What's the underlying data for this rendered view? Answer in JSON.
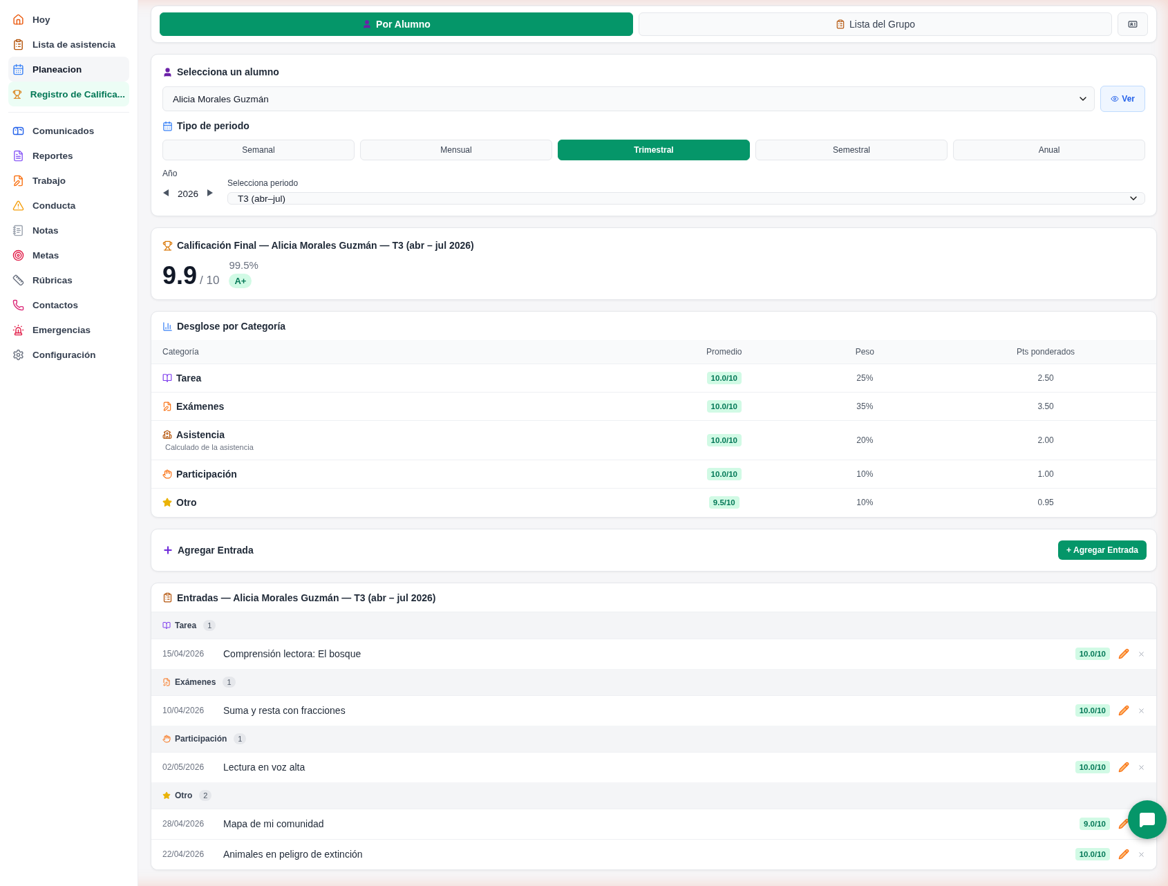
{
  "sidebar": {
    "items": [
      {
        "label": "Hoy",
        "selected": false,
        "hovered": false
      },
      {
        "label": "Lista de asistencia",
        "selected": false,
        "hovered": false
      },
      {
        "label": "Planeacion",
        "selected": false,
        "hovered": true
      },
      {
        "label": "Registro de Califica...",
        "selected": true,
        "hovered": false
      }
    ],
    "items_secondary": [
      {
        "label": "Comunicados",
        "selected": false,
        "hovered": false
      },
      {
        "label": "Reportes",
        "selected": false,
        "hovered": false
      },
      {
        "label": "Trabajo",
        "selected": false,
        "hovered": false
      },
      {
        "label": "Conducta",
        "selected": false,
        "hovered": false
      },
      {
        "label": "Notas",
        "selected": false,
        "hovered": false
      },
      {
        "label": "Metas",
        "selected": false,
        "hovered": false
      },
      {
        "label": "Rúbricas",
        "selected": false,
        "hovered": false
      },
      {
        "label": "Contactos",
        "selected": false,
        "hovered": false
      },
      {
        "label": "Emergencias",
        "selected": false,
        "hovered": false
      },
      {
        "label": "Configuración",
        "selected": false,
        "hovered": false
      }
    ]
  },
  "view_tabs": [
    {
      "label": "Por Alumno",
      "selected": true
    },
    {
      "label": "Lista del Grupo",
      "selected": false
    }
  ],
  "student_picker": {
    "label": "Selecciona un alumno",
    "value": "Alicia Morales Guzmán",
    "view_button": "Ver"
  },
  "period_type": {
    "label": "Tipo de periodo",
    "options": [
      {
        "label": "Semanal",
        "selected": false
      },
      {
        "label": "Mensual",
        "selected": false
      },
      {
        "label": "Trimestral",
        "selected": true
      },
      {
        "label": "Semestral",
        "selected": false
      },
      {
        "label": "Anual",
        "selected": false
      }
    ]
  },
  "year": {
    "label": "Año",
    "value": "2026"
  },
  "period": {
    "label": "Selecciona periodo",
    "value": "T3 (abr–jul)"
  },
  "final_grade": {
    "title": "Calificación Final — Alicia Morales Guzmán — T3 (abr – jul 2026)",
    "score": "9.9",
    "out_of": "/ 10",
    "percent": "99.5%",
    "letter": "A+"
  },
  "breakdown": {
    "title": "Desglose por Categoría",
    "columns": [
      "Categoría",
      "Promedio",
      "Peso",
      "Pts ponderados"
    ],
    "rows": [
      {
        "kind": "homework",
        "category": "Tarea",
        "average": "10.0/10",
        "weight": "25%",
        "points": "2.50"
      },
      {
        "kind": "exam",
        "category": "Exámenes",
        "average": "10.0/10",
        "weight": "35%",
        "points": "3.50"
      },
      {
        "kind": "attendance",
        "category": "Asistencia",
        "note": "Calculado de la asistencia",
        "average": "10.0/10",
        "weight": "20%",
        "points": "2.00"
      },
      {
        "kind": "participation",
        "category": "Participación",
        "average": "10.0/10",
        "weight": "10%",
        "points": "1.00"
      },
      {
        "kind": "other",
        "category": "Otro",
        "average": "9.5/10",
        "weight": "10%",
        "points": "0.95"
      }
    ]
  },
  "add_entry": {
    "title": "Agregar Entrada",
    "button": "+ Agregar Entrada"
  },
  "entries": {
    "title": "Entradas — Alicia Morales Guzmán — T3 (abr – jul 2026)",
    "groups": [
      {
        "kind": "homework",
        "name": "Tarea",
        "count": "1",
        "items": [
          {
            "date": "15/04/2026",
            "title": "Comprensión lectora: El bosque",
            "score": "10.0/10"
          }
        ]
      },
      {
        "kind": "exam",
        "name": "Exámenes",
        "count": "1",
        "items": [
          {
            "date": "10/04/2026",
            "title": "Suma y resta con fracciones",
            "score": "10.0/10"
          }
        ]
      },
      {
        "kind": "participation",
        "name": "Participación",
        "count": "1",
        "items": [
          {
            "date": "02/05/2026",
            "title": "Lectura en voz alta",
            "score": "10.0/10"
          }
        ]
      },
      {
        "kind": "other",
        "name": "Otro",
        "count": "2",
        "items": [
          {
            "date": "28/04/2026",
            "title": "Mapa de mi comunidad",
            "score": "9.0/10"
          },
          {
            "date": "22/04/2026",
            "title": "Animales en peligro de extinción",
            "score": "10.0/10"
          }
        ]
      }
    ]
  }
}
